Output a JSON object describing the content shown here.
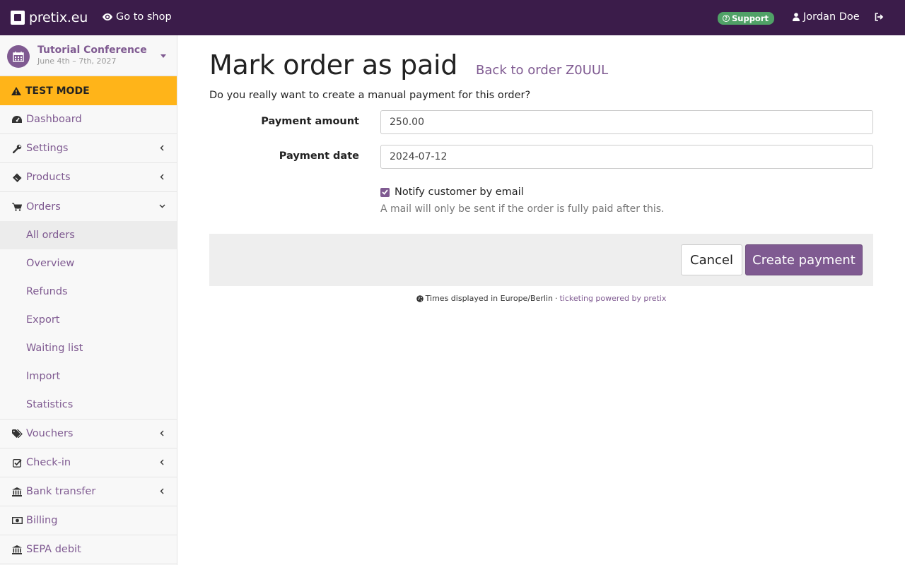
{
  "topbar": {
    "brand": "pretix.eu",
    "go_to_shop": "Go to shop",
    "support": "Support",
    "user": "Jordan Doe"
  },
  "event": {
    "name": "Tutorial Conference",
    "date": "June 4th – 7th, 2027"
  },
  "test_mode": "TEST MODE",
  "sidebar": {
    "dashboard": "Dashboard",
    "settings": "Settings",
    "products": "Products",
    "orders": "Orders",
    "orders_sub": [
      "All orders",
      "Overview",
      "Refunds",
      "Export",
      "Waiting list",
      "Import",
      "Statistics"
    ],
    "vouchers": "Vouchers",
    "checkin": "Check-in",
    "bank_transfer": "Bank transfer",
    "billing": "Billing",
    "sepa": "SEPA debit"
  },
  "main": {
    "title": "Mark order as paid",
    "back_link": "Back to order Z0UUL",
    "question": "Do you really want to create a manual payment for this order?",
    "amount_label": "Payment amount",
    "amount_value": "250.00",
    "date_label": "Payment date",
    "date_value": "2024-07-12",
    "notify_label": "Notify customer by email",
    "notify_checked": true,
    "help": "A mail will only be sent if the order is fully paid after this.",
    "cancel": "Cancel",
    "create": "Create payment"
  },
  "footer": {
    "timezone": "Times displayed in Europe/Berlin",
    "separator": "·",
    "powered": "ticketing powered by pretix"
  },
  "colors": {
    "topbar": "#3b1c4a",
    "accent": "#7f5a91",
    "test_mode": "#ffb419",
    "support": "#50a167"
  }
}
